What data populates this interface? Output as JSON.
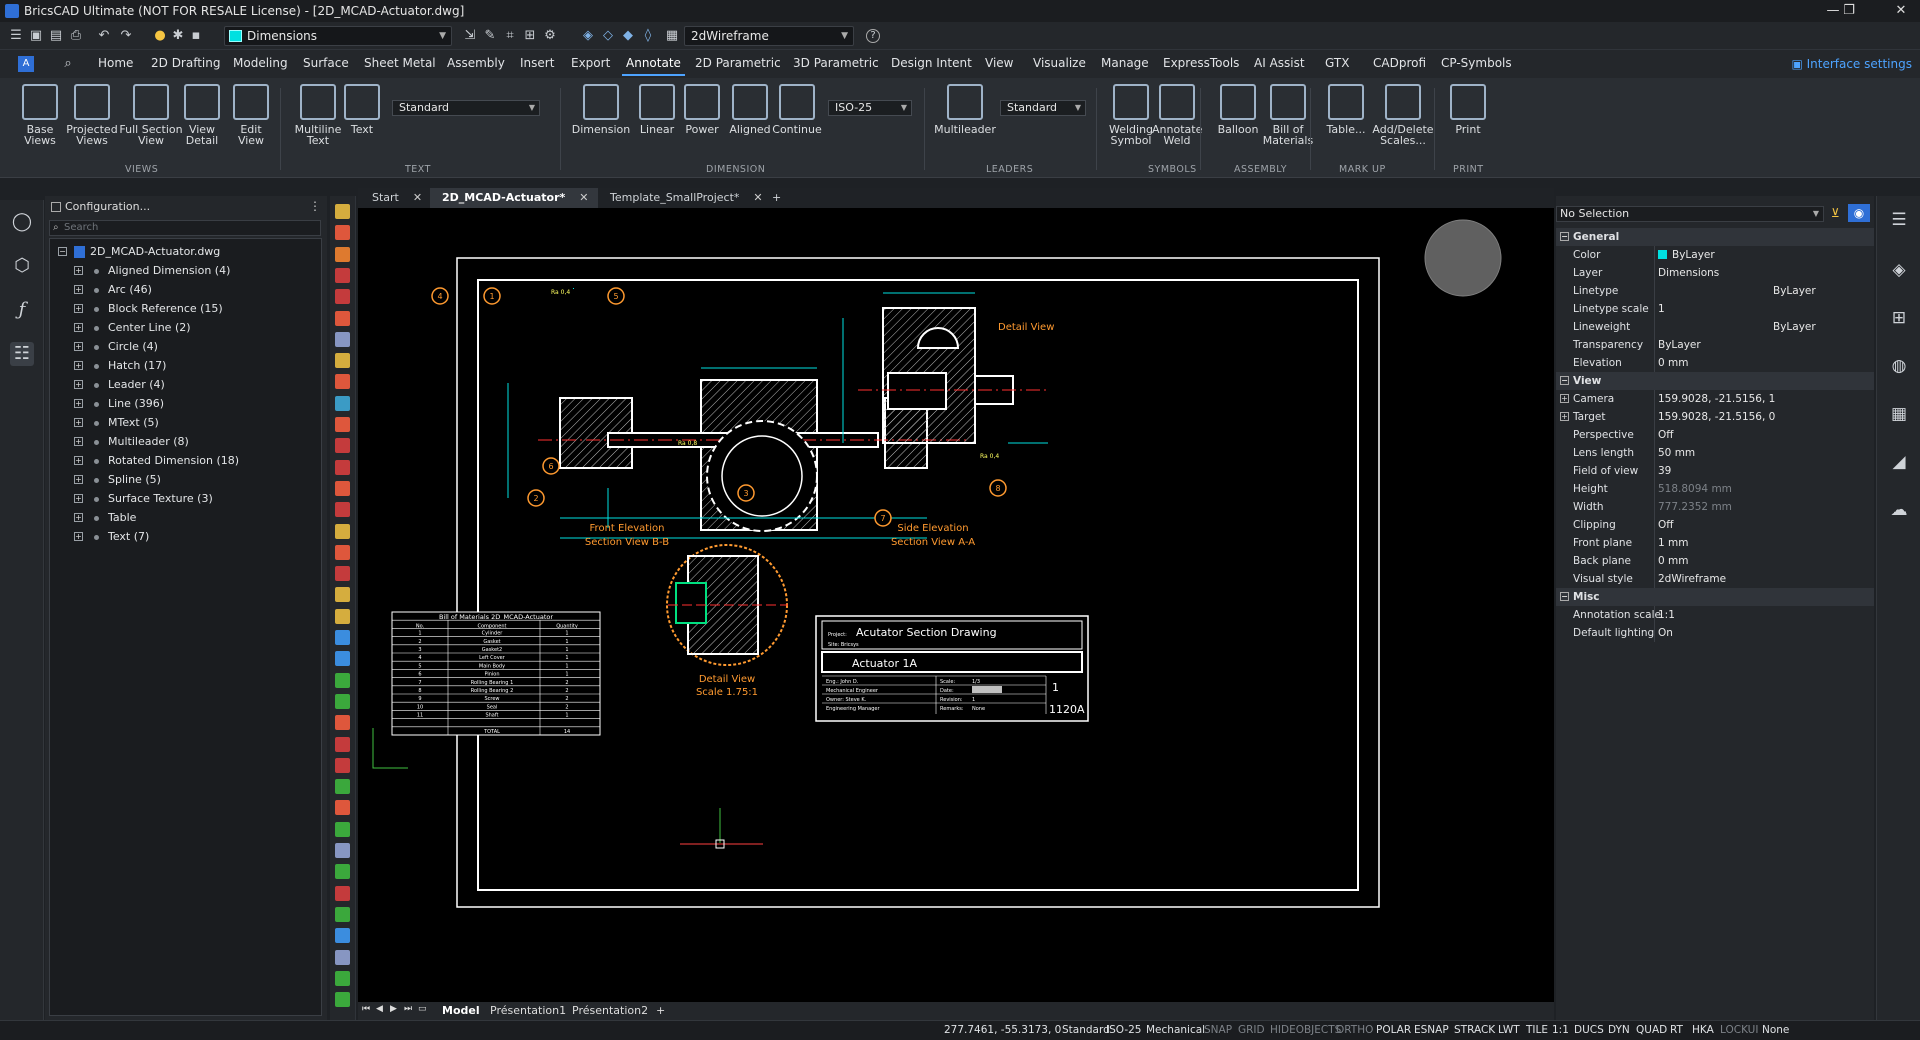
{
  "window": {
    "title": "BricsCAD Ultimate (NOT FOR RESALE License) - [2D_MCAD-Actuator.dwg]",
    "min": "—",
    "max": "❐",
    "close": "✕"
  },
  "qat": {
    "layer": "Dimensions",
    "visual_style": "2dWireframe",
    "help": "?"
  },
  "tabs": [
    "Home",
    "2D Drafting",
    "Modeling",
    "Surface",
    "Sheet Metal",
    "Assembly",
    "Insert",
    "Export",
    "Annotate",
    "2D Parametric",
    "3D Parametric",
    "Design Intent",
    "View",
    "Visualize",
    "Manage",
    "ExpressTools",
    "AI Assist",
    "GTX",
    "CADprofi",
    "CP-Symbols"
  ],
  "active_tab": "Annotate",
  "interface_settings": "Interface settings",
  "ribbon": {
    "views": [
      "Base\nViews",
      "Projected\nViews",
      "Full Section\nView",
      "View\nDetail",
      "Edit\nView"
    ],
    "text": [
      "Multiline\nText",
      "Text"
    ],
    "text_style": "Standard",
    "dimension": [
      "Dimension",
      "Linear",
      "Power",
      "Aligned",
      "Continue"
    ],
    "dim_style": "ISO-25",
    "leaders": [
      "Multileader"
    ],
    "leader_style": "Standard",
    "symbols": [
      "Welding\nSymbol",
      "Annotate\nWeld"
    ],
    "assembly": [
      "Balloon",
      "Bill of\nMaterials"
    ],
    "markup": [
      "Table...",
      "Add/Delete\nScales..."
    ],
    "print": [
      "Print"
    ],
    "groups": [
      "VIEWS",
      "TEXT",
      "DIMENSION",
      "LEADERS",
      "SYMBOLS",
      "ASSEMBLY",
      "MARK UP",
      "PRINT"
    ]
  },
  "structure": {
    "header": "Configuration...",
    "search_placeholder": "Search",
    "root": "2D_MCAD-Actuator.dwg",
    "items": [
      "Aligned Dimension (4)",
      "Arc (46)",
      "Block Reference (15)",
      "Center Line (2)",
      "Circle (4)",
      "Hatch (17)",
      "Leader (4)",
      "Line (396)",
      "MText (5)",
      "Multileader (8)",
      "Rotated Dimension (18)",
      "Spline (5)",
      "Surface Texture (3)",
      "Table",
      "Text (7)"
    ]
  },
  "doc_tabs": [
    "Start",
    "2D_MCAD-Actuator*",
    "Template_SmallProject*"
  ],
  "active_doc": "2D_MCAD-Actuator*",
  "drawing": {
    "front_label": "Front Elevation",
    "front_sub": "Section View B-B",
    "side_label": "Side Elevation",
    "side_sub": "Section View A-A",
    "detail_label": "Detail View",
    "detail_sub": "Scale 1.75:1",
    "detail_callout": "Detail View",
    "balloons": [
      "4",
      "1",
      "5",
      "6",
      "2",
      "3",
      "7",
      "8"
    ],
    "bom_title": "Bill of Materials 2D_MCAD-Actuator",
    "bom_headers": [
      "No.",
      "Component",
      "Quantity"
    ],
    "bom_rows": [
      [
        "1",
        "Cylinder",
        "1"
      ],
      [
        "2",
        "Gasket",
        "1"
      ],
      [
        "3",
        "Gasket2",
        "1"
      ],
      [
        "4",
        "Left Cover",
        "1"
      ],
      [
        "5",
        "Main Body",
        "1"
      ],
      [
        "6",
        "Pinion",
        "1"
      ],
      [
        "7",
        "Rolling Bearing 1",
        "2"
      ],
      [
        "8",
        "Rolling Bearing 2",
        "2"
      ],
      [
        "9",
        "Screw",
        "2"
      ],
      [
        "10",
        "Seal",
        "2"
      ],
      [
        "11",
        "Shaft",
        "1"
      ]
    ],
    "bom_total": [
      "TOTAL",
      "14"
    ],
    "tb_project_label": "Project:",
    "tb_project": "Acutator Section Drawing",
    "tb_site": "Site: Bricsys",
    "tb_name": "Actuator 1A",
    "tb_eng": "Eng.: John D.",
    "tb_eng_role": "Mechanical Engineer",
    "tb_owner": "Owner: Steve K.",
    "tb_owner_role": "Engineering Manager",
    "tb_scale_label": "Scale:",
    "tb_scale": "1/3",
    "tb_date_label": "Date:",
    "tb_rev_label": "Revision:",
    "tb_rev": "1",
    "tb_remarks_label": "Remarks:",
    "tb_remarks": "None",
    "tb_sheet": "1",
    "tb_number": "1120A",
    "dim_texts": [
      "Ra 0,4",
      "Ra 0,8",
      "Ra 0,4"
    ]
  },
  "layout_tabs": [
    "Model",
    "Présentation1",
    "Présentation2",
    "+"
  ],
  "props": {
    "selection": "No Selection",
    "rows": [
      {
        "t": "sec",
        "k": "General"
      },
      {
        "k": "Color",
        "v": "ByLayer",
        "swatch": "#00e0e0"
      },
      {
        "k": "Layer",
        "v": "Dimensions"
      },
      {
        "k": "Linetype",
        "vr": "ByLayer"
      },
      {
        "k": "Linetype scale",
        "v": "1"
      },
      {
        "k": "Lineweight",
        "vr": "ByLayer"
      },
      {
        "k": "Transparency",
        "v": "ByLayer"
      },
      {
        "k": "Elevation",
        "v": "0 mm"
      },
      {
        "t": "sec",
        "k": "View"
      },
      {
        "k": "Camera",
        "v": "159.9028, -21.5156, 1",
        "ex": true
      },
      {
        "k": "Target",
        "v": "159.9028, -21.5156, 0",
        "ex": true
      },
      {
        "k": "Perspective",
        "v": "Off"
      },
      {
        "k": "Lens length",
        "v": "50 mm"
      },
      {
        "k": "Field of view",
        "v": "39"
      },
      {
        "k": "Height",
        "v": "518.8094 mm",
        "dim": true
      },
      {
        "k": "Width",
        "v": "777.2352 mm",
        "dim": true
      },
      {
        "k": "Clipping",
        "v": "Off"
      },
      {
        "k": "Front plane",
        "v": "1 mm"
      },
      {
        "k": "Back plane",
        "v": "0 mm"
      },
      {
        "k": "Visual style",
        "v": "2dWireframe"
      },
      {
        "t": "sec",
        "k": "Misc"
      },
      {
        "k": "Annotation scale",
        "v": "1:1"
      },
      {
        "k": "Default lighting",
        "v": "On"
      }
    ]
  },
  "status": {
    "coords": "277.7461, -55.3173, 0",
    "items": [
      "Standard",
      "ISO-25",
      "Mechanical",
      "SNAP",
      "GRID",
      "HIDEOBJECTS",
      "ORTHO",
      "POLAR",
      "ESNAP",
      "STRACK",
      "LWT",
      "TILE",
      "1:1",
      "DUCS",
      "DYN",
      "QUAD",
      "RT",
      "HKA",
      "LOCKUI",
      "None"
    ],
    "off": [
      "SNAP",
      "GRID",
      "HIDEOBJECTS",
      "ORTHO",
      "LOCKUI"
    ]
  }
}
